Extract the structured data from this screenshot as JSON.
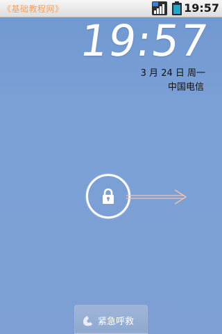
{
  "status_bar": {
    "notification_text": "《基础教程网》",
    "time": "19:57",
    "signal_icon": "signal-strength-icon",
    "battery_icon": "battery-icon",
    "battery_level_percent": 90,
    "colors": {
      "notification_text": "#f39b55",
      "battery_fill": "#22a7c9"
    }
  },
  "lockscreen": {
    "clock": "19:57",
    "date": "3 月 24 日 周一",
    "carrier": "中国电信",
    "unlock_icon": "lock-icon",
    "slide_hint_icon": "arrow-right-icon",
    "background_color": "#7aa0d6"
  },
  "emergency": {
    "icon": "phone-icon",
    "label": "紧急呼救"
  }
}
